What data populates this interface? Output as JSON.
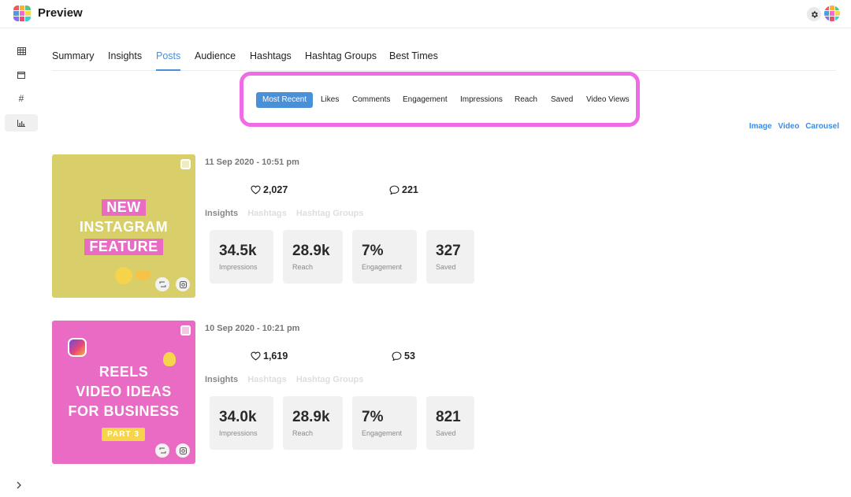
{
  "app": {
    "title": "Preview",
    "logo_colors": [
      "#f05a5a",
      "#f8b133",
      "#5cc08c",
      "#4a9be8",
      "#ef6bc8",
      "#f2d94e",
      "#8b6bf0",
      "#e94e77",
      "#3ccfcf"
    ],
    "accent": "#4a90d9"
  },
  "sidebar": {
    "items": [
      {
        "icon": "grid-icon",
        "glyph": "▦"
      },
      {
        "icon": "calendar-icon",
        "glyph": "▭"
      },
      {
        "icon": "hashtag-icon",
        "glyph": "#"
      },
      {
        "icon": "bar-chart-icon",
        "glyph": "📊"
      }
    ],
    "expand_icon": "chevron-right-icon"
  },
  "tabs": {
    "items": [
      "Summary",
      "Insights",
      "Posts",
      "Audience",
      "Hashtags",
      "Hashtag Groups",
      "Best Times"
    ],
    "active": "Posts"
  },
  "filters": {
    "items": [
      "Most Recent",
      "Likes",
      "Comments",
      "Engagement",
      "Impressions",
      "Reach",
      "Saved",
      "Video Views"
    ],
    "active": "Most Recent"
  },
  "type_links": [
    "Image",
    "Video",
    "Carousel"
  ],
  "subtabs": [
    "Insights",
    "Hashtags",
    "Hashtag Groups"
  ],
  "posts": [
    {
      "date": "11 Sep 2020 - 10:51 pm",
      "likes": "2,027",
      "comments": "221",
      "thumb_lines": [
        "NEW",
        "INSTAGRAM",
        "FEATURE"
      ],
      "thumb_bg": "#d8cf6b",
      "stats": [
        {
          "value": "34.5k",
          "label": "Impressions"
        },
        {
          "value": "28.9k",
          "label": "Reach"
        },
        {
          "value": "7%",
          "label": "Engagement"
        },
        {
          "value": "327",
          "label": "Saved"
        }
      ]
    },
    {
      "date": "10 Sep 2020 - 10:21 pm",
      "likes": "1,619",
      "comments": "53",
      "thumb_lines": [
        "REELS",
        "VIDEO IDEAS",
        "FOR BUSINESS"
      ],
      "thumb_tag": "PART 3",
      "thumb_bg": "#e96bc3",
      "stats": [
        {
          "value": "34.0k",
          "label": "Impressions"
        },
        {
          "value": "28.9k",
          "label": "Reach"
        },
        {
          "value": "7%",
          "label": "Engagement"
        },
        {
          "value": "821",
          "label": "Saved"
        }
      ]
    }
  ]
}
